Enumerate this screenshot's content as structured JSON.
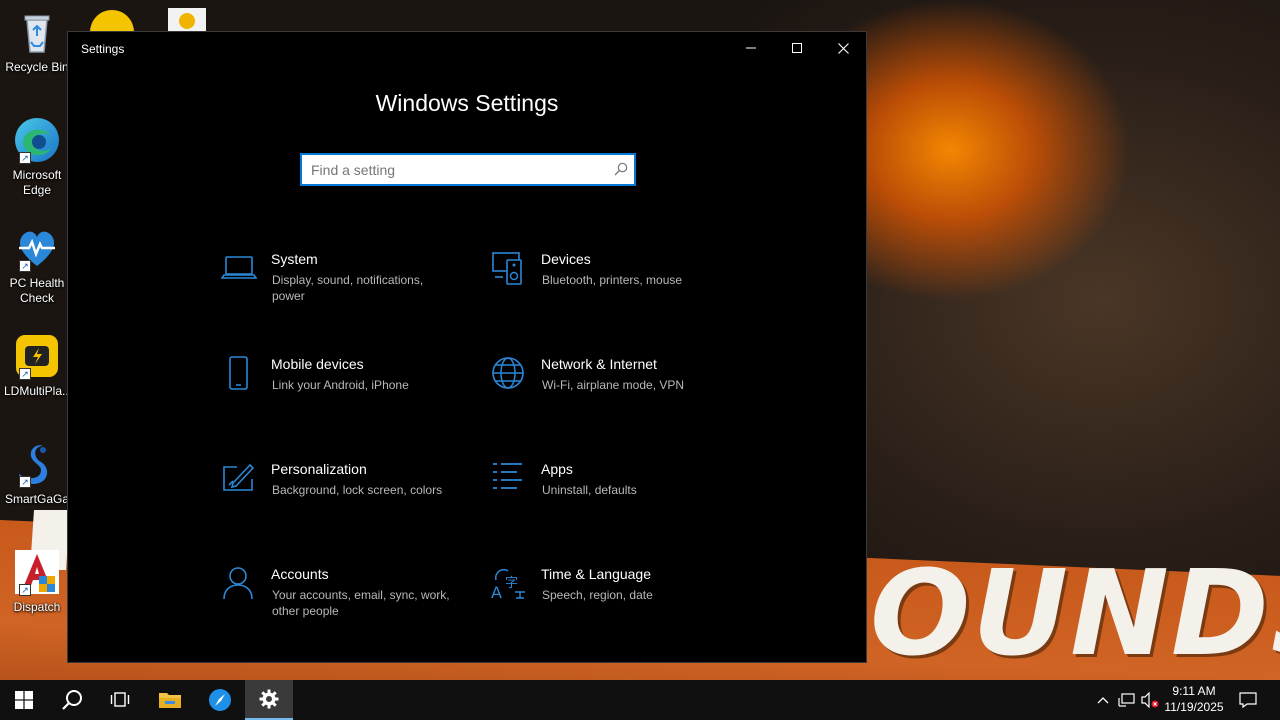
{
  "desktop": {
    "icons": [
      {
        "label": "Recycle Bin",
        "icon": "recycle-bin-icon"
      },
      {
        "label": "Microsoft Edge",
        "icon": "edge-icon"
      },
      {
        "label": "PC Health Check",
        "icon": "pc-health-check-icon"
      },
      {
        "label": "LDMultiPla...",
        "icon": "ldmultiplayer-icon"
      },
      {
        "label": "SmartGaGa",
        "icon": "smartgaga-icon"
      },
      {
        "label": "Dispatch",
        "icon": "dispatch-icon"
      }
    ],
    "banner_text": "OUNDS!"
  },
  "window": {
    "title": "Settings",
    "page_title": "Windows Settings",
    "search": {
      "placeholder": "Find a setting",
      "value": ""
    }
  },
  "tiles": [
    {
      "title": "System",
      "desc": "Display, sound, notifications, power",
      "icon": "laptop-icon"
    },
    {
      "title": "Devices",
      "desc": "Bluetooth, printers, mouse",
      "icon": "devices-icon"
    },
    {
      "title": "Mobile devices",
      "desc": "Link your Android, iPhone",
      "icon": "phone-icon"
    },
    {
      "title": "Network & Internet",
      "desc": "Wi-Fi, airplane mode, VPN",
      "icon": "globe-icon"
    },
    {
      "title": "Personalization",
      "desc": "Background, lock screen, colors",
      "icon": "personalization-icon"
    },
    {
      "title": "Apps",
      "desc": "Uninstall, defaults",
      "icon": "apps-list-icon"
    },
    {
      "title": "Accounts",
      "desc": "Your accounts, email, sync, work, other people",
      "icon": "person-icon"
    },
    {
      "title": "Time & Language",
      "desc": "Speech, region, date",
      "icon": "time-language-icon"
    }
  ],
  "taskbar": {
    "time": "9:11 AM",
    "date": "11/19/2025",
    "apps": [
      "start-icon",
      "search-icon",
      "task-view-icon",
      "file-explorer-icon",
      "browser-icon",
      "settings-gear-icon"
    ]
  },
  "colors": {
    "accent": "#0078d7",
    "tile_icon": "#2b88d8",
    "window_bg": "#000000",
    "desc_text": "#b8b8b8"
  }
}
